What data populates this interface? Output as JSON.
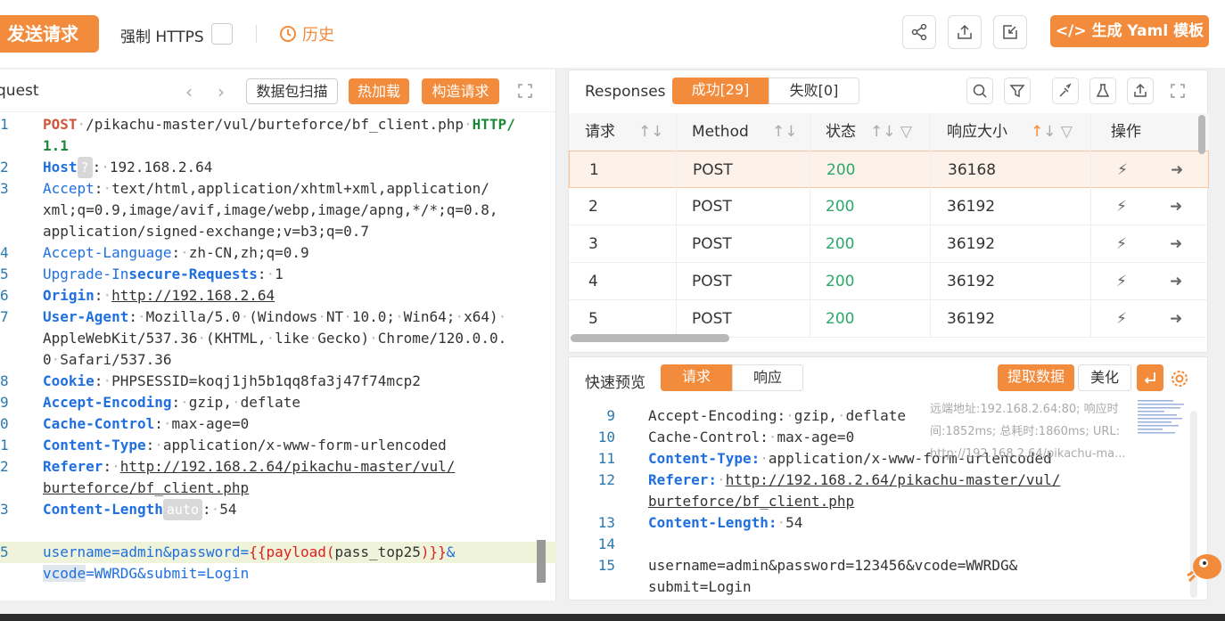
{
  "toolbar": {
    "send_label": "发送请求",
    "https_label": "强制 HTTPS",
    "history_label": "历史",
    "yaml_label": "生成 Yaml 模板"
  },
  "request_panel": {
    "title": "quest",
    "scan_label": "数据包扫描",
    "hotload_label": "热加载",
    "construct_label": "构造请求",
    "lines": [
      {
        "n": "1",
        "parts": [
          [
            "k-red",
            "POST"
          ],
          [
            "dot",
            "·"
          ],
          [
            "txt",
            "/pikachu-master/vul/burteforce/bf_client.php"
          ],
          [
            "dot",
            "·"
          ],
          [
            "k-green",
            "HTTP/"
          ]
        ]
      },
      {
        "n": "",
        "parts": [
          [
            "k-green",
            "1.1"
          ]
        ]
      },
      {
        "n": "2",
        "parts": [
          [
            "k-blue",
            "Host"
          ],
          [
            "badge",
            "?"
          ],
          [
            "txt",
            ":"
          ],
          [
            "dot",
            "·"
          ],
          [
            "txt",
            "192.168.2.64"
          ]
        ]
      },
      {
        "n": "3",
        "parts": [
          [
            "k-blue-n",
            "Accept"
          ],
          [
            "txt",
            ":"
          ],
          [
            "dot",
            "·"
          ],
          [
            "txt",
            "text/html,application/xhtml+xml,application/"
          ]
        ]
      },
      {
        "n": "",
        "parts": [
          [
            "txt",
            "xml;q=0.9,image/avif,image/webp,image/apng,*/*;q=0.8,"
          ]
        ]
      },
      {
        "n": "",
        "parts": [
          [
            "txt",
            "application/signed-exchange;v=b3;q=0.7"
          ]
        ]
      },
      {
        "n": "4",
        "parts": [
          [
            "k-blue-n",
            "Accept-Language"
          ],
          [
            "txt",
            ":"
          ],
          [
            "dot",
            "·"
          ],
          [
            "txt",
            "zh-CN,zh;q=0.9"
          ]
        ]
      },
      {
        "n": "5",
        "parts": [
          [
            "k-blue-n",
            "Upgrade-In"
          ],
          [
            "k-blue",
            "secure-Requests"
          ],
          [
            "txt",
            ":"
          ],
          [
            "dot",
            "·"
          ],
          [
            "txt",
            "1"
          ]
        ]
      },
      {
        "n": "6",
        "parts": [
          [
            "k-blue",
            "Origin"
          ],
          [
            "txt",
            ":"
          ],
          [
            "dot",
            "·"
          ],
          [
            "u",
            "http://192.168.2.64"
          ]
        ]
      },
      {
        "n": "7",
        "parts": [
          [
            "k-blue",
            "User-Agent"
          ],
          [
            "txt",
            ":"
          ],
          [
            "dot",
            "·"
          ],
          [
            "txt",
            "Mozilla/5.0"
          ],
          [
            "dot",
            "·"
          ],
          [
            "txt",
            "(Windows"
          ],
          [
            "dot",
            "·"
          ],
          [
            "txt",
            "NT"
          ],
          [
            "dot",
            "·"
          ],
          [
            "txt",
            "10.0;"
          ],
          [
            "dot",
            "·"
          ],
          [
            "txt",
            "Win64;"
          ],
          [
            "dot",
            "·"
          ],
          [
            "txt",
            "x64)"
          ],
          [
            "dot",
            "·"
          ]
        ]
      },
      {
        "n": "",
        "parts": [
          [
            "txt",
            "AppleWebKit/537.36"
          ],
          [
            "dot",
            "·"
          ],
          [
            "txt",
            "(KHTML,"
          ],
          [
            "dot",
            "·"
          ],
          [
            "txt",
            "like"
          ],
          [
            "dot",
            "·"
          ],
          [
            "txt",
            "Gecko)"
          ],
          [
            "dot",
            "·"
          ],
          [
            "txt",
            "Chrome/120.0.0."
          ]
        ]
      },
      {
        "n": "",
        "parts": [
          [
            "txt",
            "0"
          ],
          [
            "dot",
            "·"
          ],
          [
            "txt",
            "Safari/537.36"
          ]
        ]
      },
      {
        "n": "8",
        "parts": [
          [
            "k-blue",
            "Cookie"
          ],
          [
            "txt",
            ":"
          ],
          [
            "dot",
            "·"
          ],
          [
            "txt",
            "PHPSESSID=koqj1jh5b1qq8fa3j47f74mcp2"
          ]
        ]
      },
      {
        "n": "9",
        "parts": [
          [
            "k-blue",
            "Accept-Encoding"
          ],
          [
            "txt",
            ":"
          ],
          [
            "dot",
            "·"
          ],
          [
            "txt",
            "gzip,"
          ],
          [
            "dot",
            "·"
          ],
          [
            "txt",
            "deflate"
          ]
        ]
      },
      {
        "n": "0",
        "parts": [
          [
            "k-blue",
            "Cache-Control"
          ],
          [
            "txt",
            ":"
          ],
          [
            "dot",
            "·"
          ],
          [
            "txt",
            "max-age=0"
          ]
        ]
      },
      {
        "n": "1",
        "parts": [
          [
            "k-blue",
            "Content-Type"
          ],
          [
            "txt",
            ":"
          ],
          [
            "dot",
            "·"
          ],
          [
            "txt",
            "application/x-www-form-urlencoded"
          ]
        ]
      },
      {
        "n": "2",
        "parts": [
          [
            "k-blue",
            "Referer"
          ],
          [
            "txt",
            ":"
          ],
          [
            "dot",
            "·"
          ],
          [
            "u",
            "http://192.168.2.64/pikachu-master/vul/"
          ]
        ]
      },
      {
        "n": "",
        "parts": [
          [
            "u",
            "burteforce/bf_client.php"
          ]
        ]
      },
      {
        "n": "3",
        "parts": [
          [
            "k-blue",
            "Content-Length"
          ],
          [
            "badge",
            "auto"
          ],
          [
            "txt",
            ":"
          ],
          [
            "dot",
            "·"
          ],
          [
            "txt",
            "54"
          ]
        ]
      },
      {
        "n": "",
        "parts": []
      },
      {
        "n": "5",
        "hl": true,
        "parts": [
          [
            "k-blue-n",
            "username=admin&password="
          ],
          [
            "pl",
            "{{payload("
          ],
          [
            "txt",
            "pass_top25"
          ],
          [
            "pl",
            ")}}"
          ],
          [
            "k-blue-n",
            "&"
          ]
        ]
      },
      {
        "n": "",
        "hl": false,
        "parts": [
          [
            "k-blue-n-h",
            "vcode"
          ],
          [
            "k-blue-n",
            "=WWRDG&submit=Login"
          ]
        ]
      }
    ]
  },
  "responses": {
    "title": "Responses",
    "success_tab": "成功[29]",
    "fail_tab": "失败[0]",
    "columns": [
      "请求",
      "Method",
      "状态",
      "响应大小",
      "操作"
    ],
    "rows": [
      {
        "id": "1",
        "method": "POST",
        "status": "200",
        "size": "36168"
      },
      {
        "id": "2",
        "method": "POST",
        "status": "200",
        "size": "36192"
      },
      {
        "id": "3",
        "method": "POST",
        "status": "200",
        "size": "36192"
      },
      {
        "id": "4",
        "method": "POST",
        "status": "200",
        "size": "36192"
      },
      {
        "id": "5",
        "method": "POST",
        "status": "200",
        "size": "36192"
      }
    ]
  },
  "preview": {
    "title": "快速预览",
    "request_tab": "请求",
    "response_tab": "响应",
    "extract_label": "提取数据",
    "beautify_label": "美化",
    "tooltip_lines": [
      "远端地址:192.168.2.64:80; 响应时",
      "间:1852ms; 总耗时:1860ms; URL:",
      "http://192.168.2.64/pikachu-ma..."
    ],
    "lines": [
      {
        "n": "9",
        "parts": [
          [
            "txt",
            "Accept-Encoding:"
          ],
          [
            "dot",
            "·"
          ],
          [
            "txt",
            "gzip,"
          ],
          [
            "dot",
            "·"
          ],
          [
            "txt",
            "deflate"
          ]
        ]
      },
      {
        "n": "10",
        "parts": [
          [
            "txt",
            "Cache-Control:"
          ],
          [
            "dot",
            "·"
          ],
          [
            "txt",
            "max-age=0"
          ]
        ]
      },
      {
        "n": "11",
        "parts": [
          [
            "k-blue",
            "Content-Type:"
          ],
          [
            "dot",
            "·"
          ],
          [
            "txt",
            "application/x-www-form-urlencoded"
          ]
        ]
      },
      {
        "n": "12",
        "parts": [
          [
            "k-blue",
            "Referer:"
          ],
          [
            "dot",
            "·"
          ],
          [
            "u",
            "http://192.168.2.64/pikachu-master/vul/"
          ]
        ]
      },
      {
        "n": "",
        "parts": [
          [
            "u",
            "burteforce/bf_client.php"
          ]
        ]
      },
      {
        "n": "13",
        "parts": [
          [
            "k-blue",
            "Content-Length:"
          ],
          [
            "dot",
            "·"
          ],
          [
            "txt",
            "54"
          ]
        ]
      },
      {
        "n": "14",
        "parts": []
      },
      {
        "n": "15",
        "parts": [
          [
            "txt",
            "username=admin&password=123456&vcode=WWRDG&"
          ]
        ]
      },
      {
        "n": "",
        "parts": [
          [
            "txt",
            "submit=Login"
          ]
        ]
      }
    ]
  },
  "colors": {
    "accent": "#f28b3b",
    "status_ok": "#2ca86a",
    "keyword": "#1f6fe0"
  }
}
